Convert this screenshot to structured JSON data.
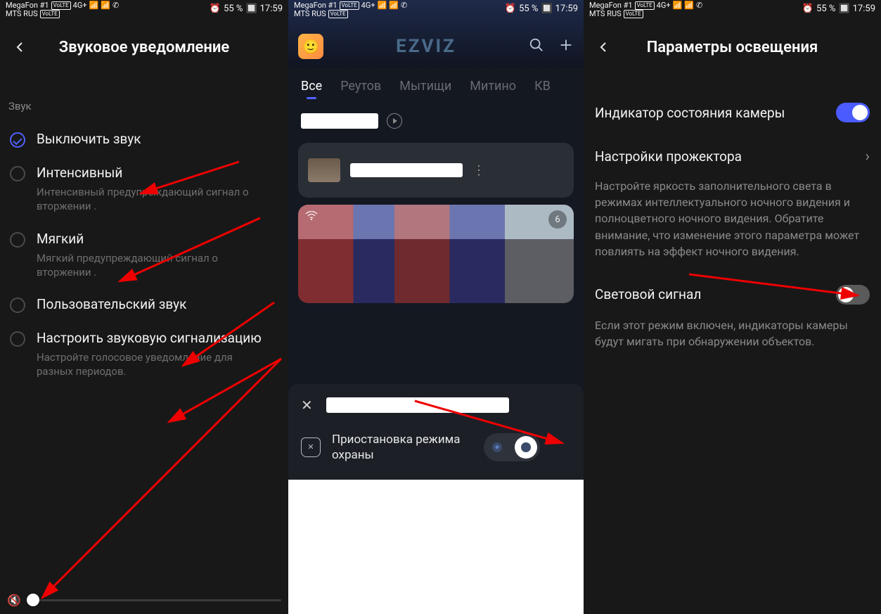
{
  "status": {
    "carrier1": "MegaFon #1",
    "carrier2": "MTS RUS",
    "volte": "VoLTE",
    "net": "4G+",
    "battery": "55 %",
    "time": "17:59"
  },
  "phone1": {
    "title": "Звуковое уведомление",
    "section": "Звук",
    "opt1_title": "Выключить звук",
    "opt2_title": "Интенсивный",
    "opt2_desc": "Интенсивный предупреждающий сигнал о вторжении .",
    "opt3_title": "Мягкий",
    "opt3_desc": "Мягкий предупреждающий сигнал о вторжении .",
    "opt4_title": "Пользовательский звук",
    "opt5_title": "Настроить звуковую сигнализацию",
    "opt5_desc": "Настройте голосовое уведомление для разных периодов."
  },
  "phone2": {
    "brand": "EZVIZ",
    "tabs": {
      "t0": "Все",
      "t1": "Реутов",
      "t2": "Мытищи",
      "t3": "Митино",
      "t4": "КВ"
    },
    "live_badge": "6",
    "sheet_label": "Приостановка режима охраны"
  },
  "phone3": {
    "title": "Параметры освещения",
    "item1": "Индикатор состояния камеры",
    "item2": "Настройки прожектора",
    "item2_desc": "Настройте яркость заполнительного света в режимах интеллектуального ночного видения и полноцветного ночного видения. Обратите внимание, что изменение этого параметра может повлиять на эффект ночного видения.",
    "item3": "Световой сигнал",
    "item3_desc": "Если этот режим включен, индикаторы камеры будут мигать при обнаружении объектов."
  }
}
